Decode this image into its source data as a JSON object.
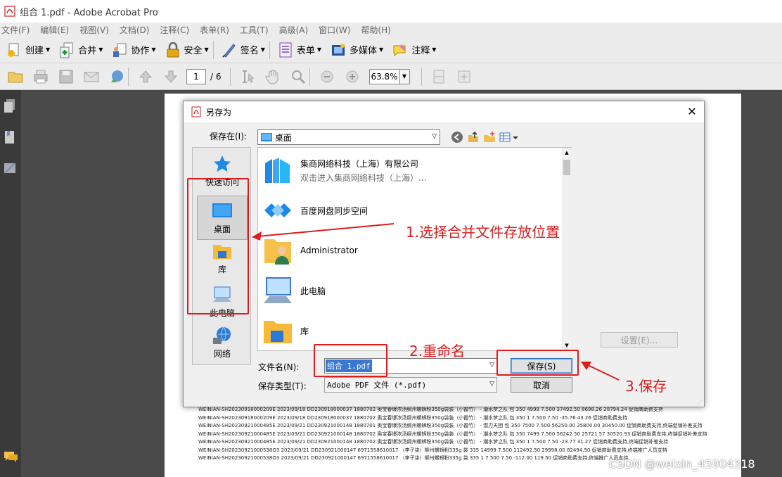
{
  "window": {
    "title": "组合 1.pdf - Adobe Acrobat Pro"
  },
  "menu": [
    "文件(F)",
    "编辑(E)",
    "视图(V)",
    "文档(D)",
    "注释(C)",
    "表单(R)",
    "工具(T)",
    "高级(A)",
    "窗口(W)",
    "帮助(H)"
  ],
  "toolbar": {
    "items": [
      {
        "label": "创建",
        "icon": "create-icon"
      },
      {
        "label": "合并",
        "icon": "combine-icon"
      },
      {
        "label": "协作",
        "icon": "collaborate-icon"
      },
      {
        "label": "安全",
        "icon": "lock-icon"
      },
      {
        "label": "签名",
        "icon": "pen-icon"
      },
      {
        "label": "表单",
        "icon": "form-icon"
      },
      {
        "label": "多媒体",
        "icon": "film-icon"
      },
      {
        "label": "注释",
        "icon": "comment-icon"
      }
    ]
  },
  "nav": {
    "page": "1",
    "total": "/ 6",
    "zoom": "63.8%"
  },
  "dialog": {
    "title": "另存为",
    "save_in_label": "保存在(I):",
    "save_in_value": "桌面",
    "places": [
      "快速访问",
      "桌面",
      "库",
      "此电脑",
      "网络"
    ],
    "files": [
      {
        "name": "集商网络科技（上海）有限公司",
        "sub": "双击进入集商网络科技（上海）..."
      },
      {
        "name": "百度网盘同步空间",
        "sub": ""
      },
      {
        "name": "Administrator",
        "sub": ""
      },
      {
        "name": "此电脑",
        "sub": ""
      },
      {
        "name": "库",
        "sub": ""
      }
    ],
    "settings_label": "设置(E)...",
    "filename_label": "文件名(N):",
    "filename_value": "组合 1.pdf",
    "filetype_label": "保存类型(T):",
    "filetype_value": "Adobe PDF 文件 (*.pdf)",
    "save_label": "保存(S)",
    "cancel_label": "取消"
  },
  "annotations": {
    "step1": "1.选择合并文件存放位置",
    "step2": "2.重命名",
    "step3": "3.保存",
    "color": "#e01b1b"
  },
  "doc_rows": [
    "WEINIAN-SH20230918000209E  2023/09/18  DD230918000037      1880702      奥宝春爆浓汤纲州螺蛳粉350g袋装（小霞竹）  - 潮水梦之队    包    350    4999   7.500    37492.50    8698.26    28794.24              促销商助费支持",
    "WEINIAN-SH20230918000209E  2023/09/18  DD230918000037      1880702      奥宝春爆浓汤纲州螺蛳粉350g袋装（小霞竹）  - 潮水梦之队    包    350    1        7.500    7.50          -35.76       43.26                   促销商助费支持",
    "WEINIAN-SH20230921000485E  2023/09/21  DD230921000148      1880701      奥宝春爆浓汤纲州螺蛳粉350g袋装（小霞竹） - 潜力天团   包    350    7500   7.500    56250.00    25800.00    30450.00       促销商助费支持,终端促销补差支持",
    "WEINIAN-SH20230921000485E  2023/09/21  DD230921000148      1880702      奥宝春爆浓汤纲州螺蛳粉350g袋装（小霞竹）  - 潮水梦之队    包    350    7499   7.500    56242.50    25721.57    30520.93       促销商助费支持,终端促销补差支持",
    "WEINIAN-SH20230921000485E  2023/09/21  DD230921000148      1880702      奥宝春爆浓汤纲州螺蛳粉350g袋装（小霞竹）  - 潮水梦之队    包    350    1        7.500    7.50          -23.77       31.27                   促销商助费支持,终端促销补差支持",
    "WEINIAN-SH20230921000538O3  2023/09/21  DD230921000147  6971558610017          （李子柒）柳州螺蛳粉335g                         袋    335    14999  7.500    112492.50  29998.00    82494.50       促销商助费支持,终端推广人员支持",
    "WEINIAN-SH20230921000538O3  2023/09/21  DD230921000147  6971558610017          （李子柒）柳州螺蛳粉335g                         袋    335    1        7.500    7.50          -112.00      119.50                  促销商助费支持,终端推广人员支持"
  ],
  "watermark": "CSDN @weixin_45904318"
}
